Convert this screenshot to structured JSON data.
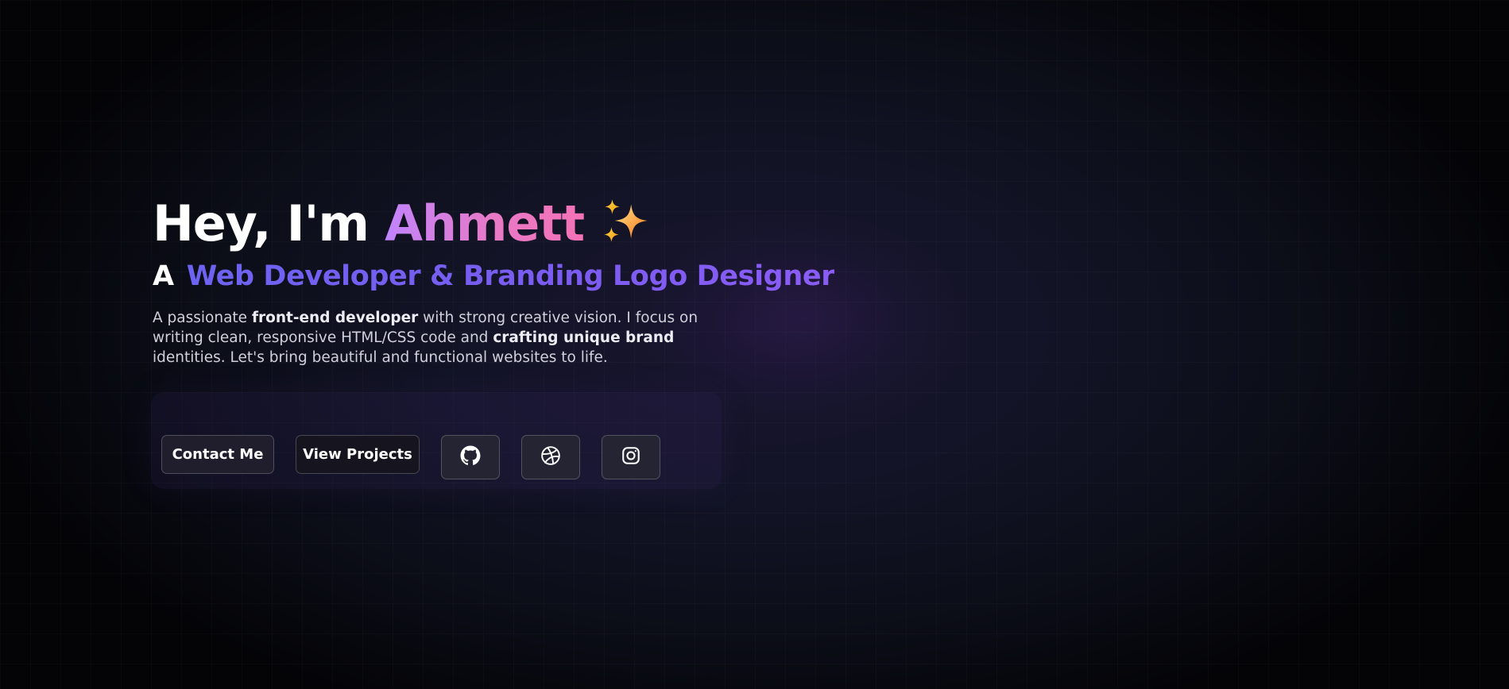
{
  "hero": {
    "greeting": "Hey, I'm ",
    "name": "Ahmett",
    "sparkle_icon": "sparkles-icon",
    "subtitle_prefix": "A",
    "subtitle_role": "Web Developer & Branding Logo Designer",
    "description": {
      "part1": "A passionate ",
      "bold1": "front-end developer",
      "part2": " with strong creative vision. I focus on writing clean, responsive HTML/CSS code and ",
      "bold2": "crafting unique brand",
      "part3": " identities. Let's bring beautiful and functional websites to life."
    }
  },
  "actions": {
    "contact_label": "Contact Me",
    "projects_label": "View Projects",
    "social": [
      {
        "icon": "github-icon"
      },
      {
        "icon": "dribbble-icon"
      },
      {
        "icon": "instagram-icon"
      }
    ]
  },
  "colors": {
    "name_gradient_start": "#c084fc",
    "name_gradient_end": "#f472b6",
    "role_color": "#7260f2",
    "sparkle": "#f59e0b"
  }
}
